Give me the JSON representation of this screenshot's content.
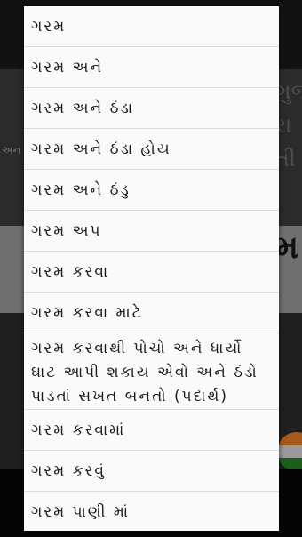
{
  "background": {
    "side_label": "અન",
    "art_glyphs": "ગુજ રા તી",
    "band_glyph": "મ",
    "flag_colors": [
      "#a65a1a",
      "#9a9a9a",
      "#1d5e1d"
    ]
  },
  "suggestions": [
    "ગરમ",
    "ગરમ અને",
    "ગરમ અને ઠંડા",
    "ગરમ અને ઠંડા હોય",
    "ગરમ અને ઠંડુ",
    "ગરમ અપ",
    "ગરમ કરવા",
    "ગરમ કરવા માટે",
    "ગરમ કરવાથી પોચો અને ધાર્યો ઘાટ આપી શકાય એવો અને ઠંડો પાડતાં સખત બનતો (પદાર્થ)",
    "ગરમ કરવામાં",
    "ગરમ કરવું",
    "ગરમ પાણી માં"
  ]
}
